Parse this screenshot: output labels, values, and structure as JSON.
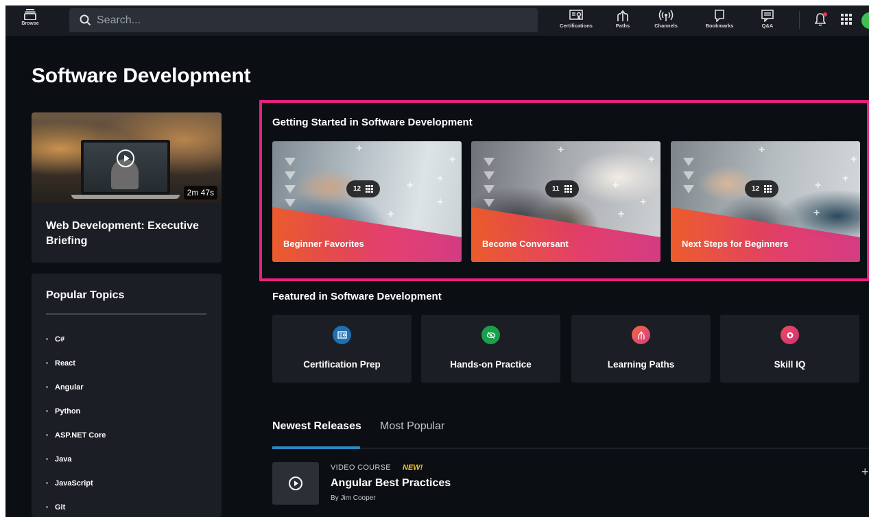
{
  "nav": {
    "browse_label": "Browse",
    "search_placeholder": "Search...",
    "links": [
      {
        "label": "Certifications",
        "icon": "certification-icon"
      },
      {
        "label": "Paths",
        "icon": "paths-icon"
      },
      {
        "label": "Channels",
        "icon": "channels-icon"
      },
      {
        "label": "Bookmarks",
        "icon": "bookmark-icon"
      },
      {
        "label": "Q&A",
        "icon": "qa-icon"
      }
    ],
    "notification_dot_color": "#f0364a",
    "avatar_color": "#3dbf52"
  },
  "page": {
    "title": "Software Development"
  },
  "video": {
    "duration": "2m 47s",
    "title": "Web Development: Executive Briefing"
  },
  "topics": {
    "title": "Popular Topics",
    "items": [
      "C#",
      "React",
      "Angular",
      "Python",
      "ASP.NET Core",
      "Java",
      "JavaScript",
      "Git"
    ]
  },
  "getting_started": {
    "title": "Getting Started in Software Development",
    "highlight_color": "#e8207f",
    "cards": [
      {
        "label": "Beginner Favorites",
        "count": "12"
      },
      {
        "label": "Become Conversant",
        "count": "11"
      },
      {
        "label": "Next Steps for Beginners",
        "count": "12"
      }
    ]
  },
  "featured": {
    "title": "Featured in Software Development",
    "items": [
      {
        "label": "Certification Prep",
        "icon": "certification-prep-icon",
        "color": "#1f6fb3"
      },
      {
        "label": "Hands-on Practice",
        "icon": "hands-on-practice-icon",
        "color": "#18a04a"
      },
      {
        "label": "Learning Paths",
        "icon": "learning-paths-icon",
        "color": "#e0407a"
      },
      {
        "label": "Skill IQ",
        "icon": "skill-iq-icon",
        "color": "#e0306a"
      }
    ]
  },
  "tabs": {
    "items": [
      "Newest Releases",
      "Most Popular"
    ],
    "active": "Newest Releases",
    "accent_color": "#2a89c9"
  },
  "courses": [
    {
      "type": "VIDEO COURSE",
      "badge": "NEW!",
      "title": "Angular Best Practices",
      "author": "By Jim Cooper"
    }
  ]
}
